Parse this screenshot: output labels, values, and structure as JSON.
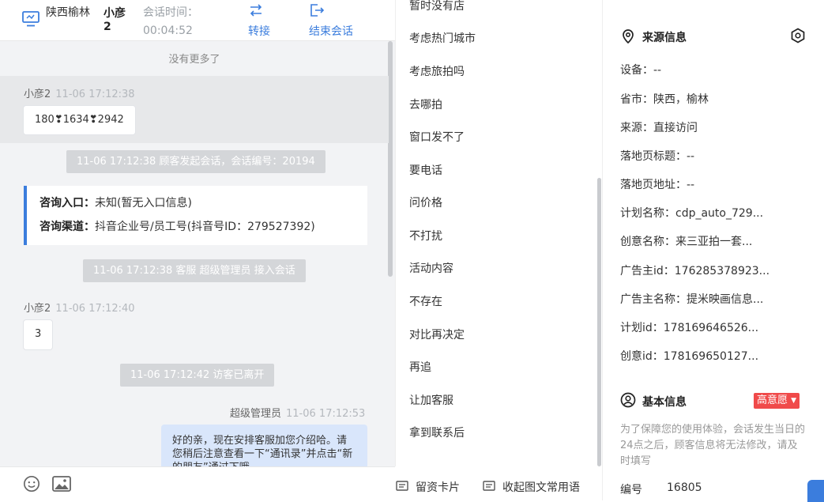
{
  "header": {
    "location": "陕西榆林",
    "visitor_name": "小彦2",
    "time_label": "会话时间：",
    "time_value": "00:04:52",
    "transfer_label": "转接",
    "end_label": "结束会话"
  },
  "chat": {
    "no_more": "没有更多了",
    "messages": [
      {
        "sender": "小彦2",
        "time": "11-06 17:12:38",
        "text": "180❣1634❣2942"
      },
      {
        "system": "11-06 17:12:38 顾客发起会话，会话编号：20194"
      },
      {
        "system": "11-06 17:12:38 客服 超级管理员 接入会话"
      },
      {
        "sender": "小彦2",
        "time": "11-06 17:12:40",
        "text": "3"
      },
      {
        "system": "11-06 17:12:42 访客已离开"
      },
      {
        "sender": "超级管理员",
        "time": "11-06 17:12:53",
        "text": "好的亲，现在安排客服加您介绍哈。请您稍后注意查看一下“通讯录”并点击“新的朋友”通过下哦"
      }
    ],
    "info_card": {
      "entry_label": "咨询入口：",
      "entry_value": "未知(暂无入口信息)",
      "channel_label": "咨询渠道：",
      "channel_value": "抖音企业号/员工号(抖音号ID：279527392)"
    }
  },
  "footer": {
    "leave_card": "留资卡片",
    "collapse_common": "收起图文常用语"
  },
  "quick_replies": [
    "暂时没有店",
    "考虑热门城市",
    "考虑旅拍吗",
    "去哪拍",
    "窗口发不了",
    "要电话",
    "问价格",
    "不打扰",
    "活动内容",
    "不存在",
    "对比再决定",
    "再追",
    "让加客服",
    "拿到联系后"
  ],
  "source_info": {
    "title": "来源信息",
    "rows": [
      "设备：--",
      "省市：陕西，榆林",
      "来源：直接访问",
      "落地页标题：--",
      "落地页地址：--",
      "计划名称：cdp_auto_729...",
      "创意名称：来三亚拍一套...",
      "广告主id：176285378923...",
      "广告主名称：提米映画信息...",
      "计划id：178169646526...",
      "创意id：178169650127..."
    ]
  },
  "basic_info": {
    "title": "基本信息",
    "intent_badge": "高意愿",
    "note": "为了保障您的使用体验，会话发生当日的24点之后，顾客信息将无法修改，请及时填写",
    "id_label": "编号",
    "id_value": "16805"
  },
  "colors": {
    "accent": "#3b7ddd",
    "badge": "#f04a4a"
  }
}
